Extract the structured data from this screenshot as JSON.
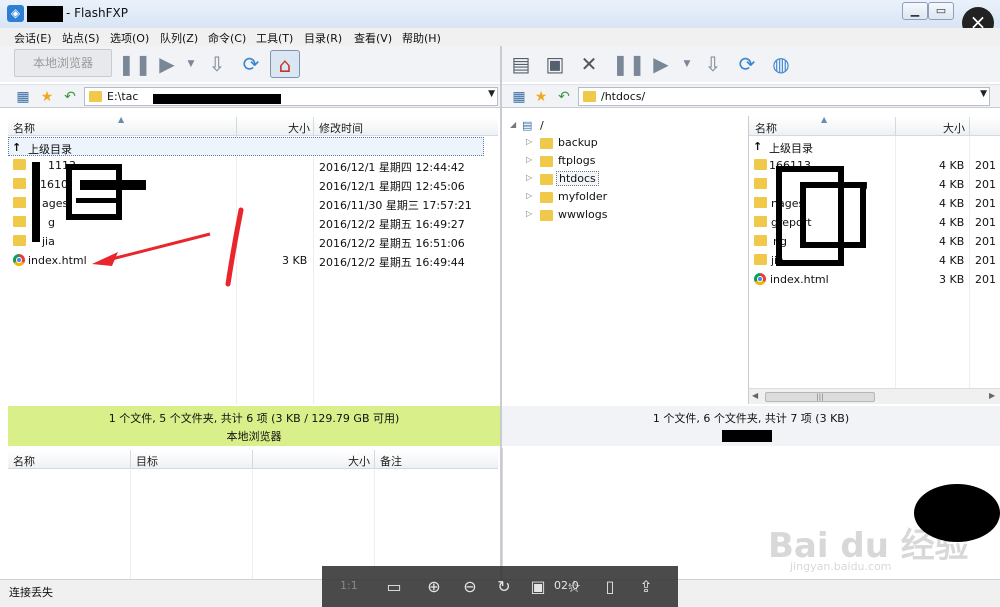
{
  "window": {
    "title": "- FlashFXP",
    "close_label": "×",
    "minimize_label": "▁",
    "restore_label": "▭"
  },
  "menu": [
    "会话(E)",
    "站点(S)",
    "选项(O)",
    "队列(Z)",
    "命令(C)",
    "工具(T)",
    "目录(R)",
    "查看(V)",
    "帮助(H)"
  ],
  "left_toolbar": {
    "browser_label": "本地浏览器"
  },
  "left_path": {
    "value": "E:\\tac"
  },
  "right_path": {
    "value": "/htdocs/"
  },
  "left_list": {
    "columns": [
      "名称",
      "大小",
      "修改时间"
    ],
    "parent_label": "上级目录",
    "rows": [
      {
        "name": "1113",
        "size": "",
        "date": "2016/12/1 星期四 12:44:42",
        "type": "folder"
      },
      {
        "name": "1610",
        "size": "",
        "date": "2016/12/1 星期四 12:45:06",
        "type": "folder"
      },
      {
        "name": "ages",
        "size": "",
        "date": "2016/11/30 星期三 17:57:21",
        "type": "folder"
      },
      {
        "name": "g",
        "size": "",
        "date": "2016/12/2 星期五 16:49:27",
        "type": "folder"
      },
      {
        "name": "jia",
        "size": "",
        "date": "2016/12/2 星期五 16:51:06",
        "type": "folder"
      },
      {
        "name": "index.html",
        "size": "3 KB",
        "date": "2016/12/2 星期五 16:49:44",
        "type": "html"
      }
    ],
    "status": "1 个文件, 5 个文件夹, 共计 6 项 (3 KB / 129.79 GB 可用)",
    "status_sub": "本地浏览器",
    "status_color": "#d9f08a"
  },
  "right_tree": {
    "root": "/",
    "nodes": [
      "backup",
      "ftplogs",
      "htdocs",
      "myfolder",
      "wwwlogs"
    ],
    "selected": "htdocs"
  },
  "right_list": {
    "columns": [
      "名称",
      "大小"
    ],
    "parent_label": "上级目录",
    "rows": [
      {
        "name": "166113",
        "size": "4 KB",
        "extra": "201",
        "type": "folder"
      },
      {
        "name": "g",
        "size": "4 KB",
        "extra": "201",
        "type": "folder"
      },
      {
        "name": "nages",
        "size": "4 KB",
        "extra": "201",
        "type": "folder"
      },
      {
        "name": "greport",
        "size": "4 KB",
        "extra": "201",
        "type": "folder"
      },
      {
        "name": "ng",
        "size": "4 KB",
        "extra": "201",
        "type": "folder"
      },
      {
        "name": "jia",
        "size": "4 KB",
        "extra": "201",
        "type": "folder"
      },
      {
        "name": "index.html",
        "size": "3 KB",
        "extra": "201",
        "type": "html"
      }
    ],
    "status": "1 个文件, 6 个文件夹, 共计 7 项 (3 KB)"
  },
  "queue": {
    "columns": [
      "名称",
      "目标",
      "大小",
      "备注"
    ]
  },
  "bottom_status": {
    "text": "连接丢失"
  },
  "viewer_bar": {
    "ratio_label": "1:1",
    "time_text": "02:0"
  },
  "watermark": {
    "brand": "Bai du 经验",
    "url": "jingyan.baidu.com"
  }
}
